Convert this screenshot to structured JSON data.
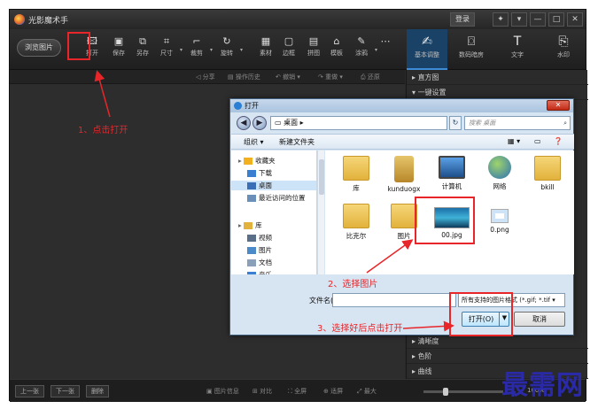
{
  "app": {
    "title": "光影魔术手",
    "login": "登录",
    "win_buttons": [
      "✦",
      "▾",
      "—",
      "□",
      "✕"
    ]
  },
  "toolbar": {
    "browse": "浏览图片",
    "tools": [
      {
        "label": "打开",
        "icon": "open-icon",
        "glyph": "🖾"
      },
      {
        "label": "保存",
        "icon": "save-icon",
        "glyph": "▣"
      },
      {
        "label": "另存",
        "icon": "saveas-icon",
        "glyph": "⧉"
      },
      {
        "label": "尺寸",
        "icon": "resize-icon",
        "glyph": "⌗"
      },
      {
        "label": "裁剪",
        "icon": "crop-icon",
        "glyph": "⌐"
      },
      {
        "label": "旋转",
        "icon": "rotate-icon",
        "glyph": "↻"
      },
      {
        "label": "素材",
        "icon": "material-icon",
        "glyph": "▦"
      },
      {
        "label": "边框",
        "icon": "frame-icon",
        "glyph": "▢"
      },
      {
        "label": "拼图",
        "icon": "collage-icon",
        "glyph": "▤"
      },
      {
        "label": "模板",
        "icon": "template-icon",
        "glyph": "⌂"
      },
      {
        "label": "涂鸦",
        "icon": "brush-icon",
        "glyph": "✎"
      },
      {
        "label": "",
        "icon": "more-icon",
        "glyph": "⋯"
      }
    ],
    "right_tabs": [
      {
        "label": "基本调整",
        "icon": "adjust-icon",
        "glyph": "✍"
      },
      {
        "label": "数码暗房",
        "icon": "darkroom-icon",
        "glyph": "⌼"
      },
      {
        "label": "文字",
        "icon": "text-icon",
        "glyph": "T"
      },
      {
        "label": "水印",
        "icon": "watermark-icon",
        "glyph": "⎘"
      }
    ]
  },
  "subbar": {
    "share": "分享",
    "history": "操作历史",
    "undo": "撤销",
    "redo": "重做",
    "restore": "还原"
  },
  "right_panel": {
    "rows": [
      "直方图",
      "一键设置",
      "清晰度",
      "色阶",
      "曲线"
    ]
  },
  "status": {
    "prev": "上一张",
    "next": "下一张",
    "delete": "删除",
    "info": "图片信息",
    "compare": "对比",
    "fullscreen": "全屏",
    "fit": "适屏",
    "max": "最大",
    "zoom": "100%"
  },
  "dialog": {
    "title": "打开",
    "address": "桌面 ▸",
    "search_placeholder": "搜索 桌面",
    "organize": "组织 ▾",
    "new_folder": "新建文件夹",
    "nav": [
      {
        "label": "收藏夹",
        "icon": "star-icon",
        "indent": 0,
        "sel": false
      },
      {
        "label": "下载",
        "icon": "download-icon",
        "indent": 1,
        "sel": false
      },
      {
        "label": "桌面",
        "icon": "desktop-icon",
        "indent": 1,
        "sel": true
      },
      {
        "label": "最近访问的位置",
        "icon": "recent-icon",
        "indent": 1,
        "sel": false
      },
      {
        "label": "库",
        "icon": "library-icon",
        "indent": 0,
        "sel": false
      },
      {
        "label": "视频",
        "icon": "video-icon",
        "indent": 1,
        "sel": false
      },
      {
        "label": "图片",
        "icon": "picture-icon",
        "indent": 1,
        "sel": false
      },
      {
        "label": "文档",
        "icon": "document-icon",
        "indent": 1,
        "sel": false
      },
      {
        "label": "音乐",
        "icon": "music-icon",
        "indent": 1,
        "sel": false
      }
    ],
    "files": [
      {
        "label": "库",
        "kind": "folder"
      },
      {
        "label": "kunduogx",
        "kind": "user"
      },
      {
        "label": "计算机",
        "kind": "computer"
      },
      {
        "label": "网络",
        "kind": "network"
      },
      {
        "label": "bkill",
        "kind": "folder"
      },
      {
        "label": "比克尔",
        "kind": "folder"
      },
      {
        "label": "图片",
        "kind": "folder"
      },
      {
        "label": "00.jpg",
        "kind": "image"
      },
      {
        "label": "0.png",
        "kind": "png"
      }
    ],
    "filename_label": "文件名(N):",
    "filename_value": "",
    "filetype": "所有支持的图片格式 (*.gif; *.tif",
    "open": "打开(O)",
    "cancel": "取消"
  },
  "annotations": {
    "step1": "1、点击打开",
    "step2": "2、选择图片",
    "step3": "3、选择好后点击打开",
    "color": "#e8262a"
  },
  "watermark": "最需网"
}
